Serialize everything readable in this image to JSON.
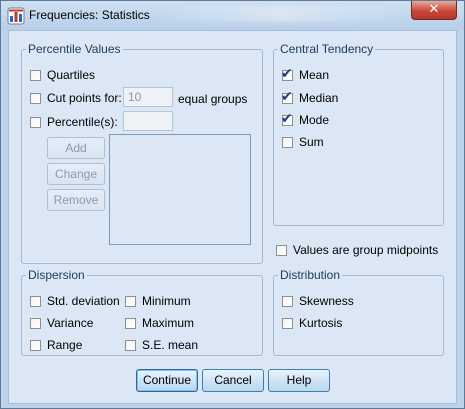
{
  "window": {
    "title": "Frequencies: Statistics",
    "close_glyph": "✕"
  },
  "percentile_values": {
    "legend": "Percentile Values",
    "quartiles": {
      "label": "Quartiles",
      "checked": false
    },
    "cut_points": {
      "label": "Cut points for:",
      "checked": false,
      "value": "10",
      "suffix": "equal groups"
    },
    "percentiles": {
      "label": "Percentile(s):",
      "checked": false,
      "value": ""
    },
    "buttons": {
      "add": "Add",
      "change": "Change",
      "remove": "Remove"
    },
    "list_items": []
  },
  "central_tendency": {
    "legend": "Central Tendency",
    "mean": {
      "label": "Mean",
      "checked": true
    },
    "median": {
      "label": "Median",
      "checked": true
    },
    "mode": {
      "label": "Mode",
      "checked": true
    },
    "sum": {
      "label": "Sum",
      "checked": false
    }
  },
  "group_midpoints": {
    "label": "Values are group midpoints",
    "checked": false
  },
  "dispersion": {
    "legend": "Dispersion",
    "std_deviation": {
      "label": "Std. deviation",
      "checked": false
    },
    "minimum": {
      "label": "Minimum",
      "checked": false
    },
    "variance": {
      "label": "Variance",
      "checked": false
    },
    "maximum": {
      "label": "Maximum",
      "checked": false
    },
    "range": {
      "label": "Range",
      "checked": false
    },
    "se_mean": {
      "label": "S.E. mean",
      "checked": false
    }
  },
  "distribution": {
    "legend": "Distribution",
    "skewness": {
      "label": "Skewness",
      "checked": false
    },
    "kurtosis": {
      "label": "Kurtosis",
      "checked": false
    }
  },
  "footer": {
    "continue": "Continue",
    "cancel": "Cancel",
    "help": "Help"
  },
  "colors": {
    "title_bar": "#bcd3ec",
    "client_bg": "#dbe7f4",
    "group_border": "#a4b9d2",
    "legend_text": "#1e395b",
    "checkmark": "#1b3f7a",
    "close_button": "#c9483a"
  },
  "icons": {
    "app": "frequencies-app-icon",
    "close": "close-icon",
    "checkbox": "checkbox-icon",
    "checkmark": "checkmark-icon"
  }
}
